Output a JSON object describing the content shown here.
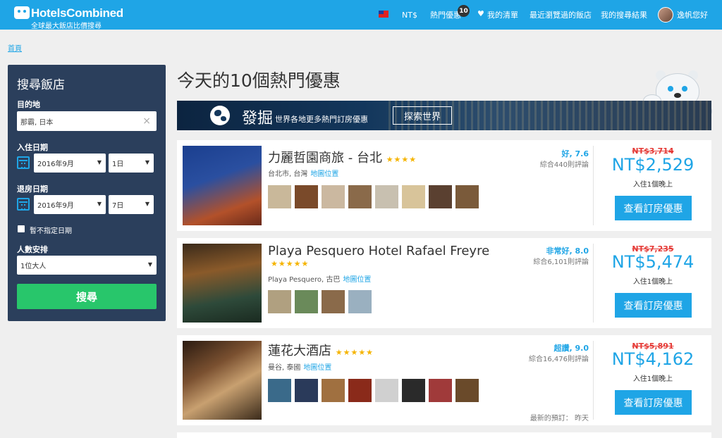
{
  "brand": {
    "name": "HotelsCombined",
    "tagline": "全球最大飯店比價搜尋",
    "primary_color": "#1fa5e6",
    "nav_bg": "#1fa5e6"
  },
  "nav": {
    "flag_icon": "taiwan-flag-icon",
    "currency": "NT$",
    "hot_deals": "熱門優惠",
    "hot_deals_badge": "10",
    "wishlist": "我的清單",
    "recent": "最近瀏覽過的飯店",
    "my_searches": "我的搜尋結果",
    "user": "逸帆您好"
  },
  "breadcrumb": "首頁",
  "search": {
    "title": "搜尋飯店",
    "destination_label": "目的地",
    "destination_value": "那霸, 日本",
    "checkin_label": "入住日期",
    "checkin_month": "2016年9月",
    "checkin_day": "1日",
    "checkout_label": "退房日期",
    "checkout_month": "2016年9月",
    "checkout_day": "7日",
    "no_dates_label": "暫不指定日期",
    "guests_label": "人數安排",
    "guests_value": "1位大人",
    "submit": "搜尋",
    "panel_color": "#2b3f5c",
    "submit_color": "#28c66b"
  },
  "main": {
    "title": "今天的10個熱門優惠",
    "banner": {
      "title": "發掘",
      "subtitle": "世界各地更多熱門訂房優惠",
      "button": "探索世界"
    }
  },
  "hotels": [
    {
      "name": "力麗哲園商旅 - 台北",
      "stars": "★★★★",
      "location": "台北市, 台灣",
      "map_link": "地圖位置",
      "rating": "好, 7.6",
      "reviews": "綜合440則評論",
      "old_price": "NT$3,714",
      "price": "NT$2,529",
      "per_night": "入住1個晚上",
      "button": "查看訂房優惠",
      "photo_colors": [
        "#1b3f8f",
        "#b3512a"
      ],
      "thumbs": [
        "#c9b89a",
        "#7a4a2a",
        "#cbb8a0",
        "#8a6a4a",
        "#c8c0b0",
        "#d8c49a",
        "#5a4030",
        "#7a5a3a"
      ]
    },
    {
      "name": "Playa Pesquero Hotel Rafael Freyre",
      "stars": "★★★★★",
      "location": "Playa Pesquero, 古巴",
      "map_link": "地圖位置",
      "rating": "非常好, 8.0",
      "reviews": "綜合6,101則評論",
      "old_price": "NT$7,235",
      "price": "NT$5,474",
      "per_night": "入住1個晚上",
      "button": "查看訂房優惠",
      "photo_colors": [
        "#6a4a2a",
        "#2e4a3a"
      ],
      "thumbs": [
        "#b0a080",
        "#6a8a5a",
        "#8a6a4a",
        "#9ab0c0"
      ]
    },
    {
      "name": "蓮花大酒店",
      "stars": "★★★★★",
      "location": "曼谷, 泰國",
      "map_link": "地圖位置",
      "rating": "超讚, 9.0",
      "reviews": "綜合16,476則評論",
      "old_price": "NT$5,891",
      "price": "NT$4,162",
      "per_night": "入住1個晚上",
      "button": "查看訂房優惠",
      "last_booked_label": "最新的預訂：",
      "last_booked_value": "昨天",
      "photo_colors": [
        "#3a2a1a",
        "#c8a070"
      ],
      "thumbs": [
        "#3a6a8a",
        "#2a3a5a",
        "#a07040",
        "#8a2a1a",
        "#d0d0d0",
        "#2a2a2a",
        "#a03a3a",
        "#6a4a2a"
      ]
    }
  ]
}
